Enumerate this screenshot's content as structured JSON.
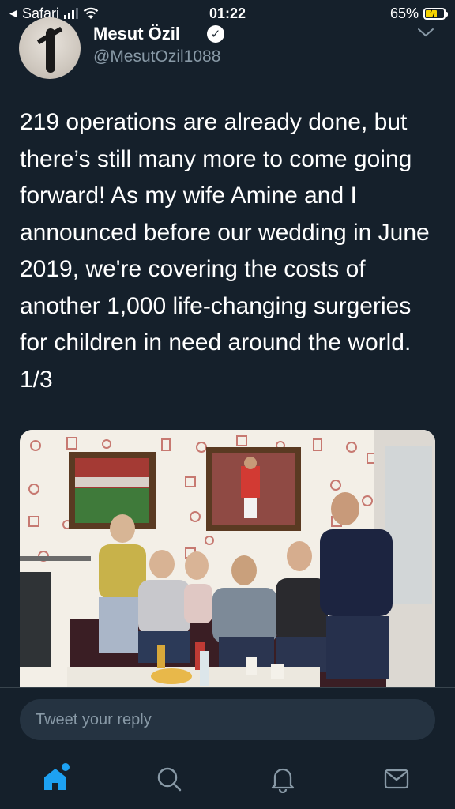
{
  "status_bar": {
    "back_app": "Safari",
    "time": "01:22",
    "battery": "65%",
    "battery_level": 0.65
  },
  "tweet": {
    "author_name": "Mesut Özil",
    "handle": "@MesutOzil1088",
    "text": "219 operations are already done, but there’s still many more to come going forward! As my wife Amine and I announced before our wedding in June 2019, we're covering the costs of another 1,000 life-changing surgeries for children in need around the world. 1/3"
  },
  "reply": {
    "placeholder": "Tweet your reply"
  },
  "tabs": [
    {
      "icon": "home-icon"
    },
    {
      "icon": "search-icon"
    },
    {
      "icon": "bell-icon"
    },
    {
      "icon": "mail-icon"
    }
  ],
  "colors": {
    "background": "#15202b",
    "accent": "#1da1f2",
    "secondary_text": "#8899a6",
    "input_bg": "#253341"
  }
}
